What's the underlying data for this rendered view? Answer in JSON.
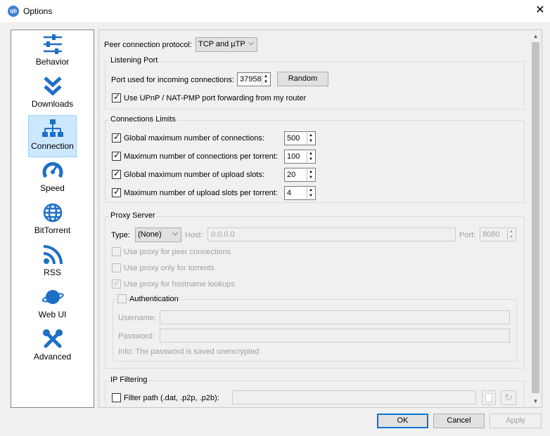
{
  "window": {
    "title": "Options",
    "app_icon": "qb"
  },
  "sidebar": {
    "items": [
      {
        "label": "Behavior",
        "icon": "sliders-icon"
      },
      {
        "label": "Downloads",
        "icon": "double-chevron-down-icon"
      },
      {
        "label": "Connection",
        "icon": "network-icon",
        "selected": true
      },
      {
        "label": "Speed",
        "icon": "speedometer-icon"
      },
      {
        "label": "BitTorrent",
        "icon": "globe-icon"
      },
      {
        "label": "RSS",
        "icon": "rss-icon"
      },
      {
        "label": "Web UI",
        "icon": "planet-icon"
      },
      {
        "label": "Advanced",
        "icon": "tools-icon"
      }
    ]
  },
  "protocol": {
    "label": "Peer connection protocol:",
    "value": "TCP and µTP"
  },
  "listening": {
    "title": "Listening Port",
    "port_label": "Port used for incoming connections:",
    "port_value": "37958",
    "random_button": "Random",
    "upnp_label": "Use UPnP / NAT-PMP port forwarding from my router"
  },
  "limits": {
    "title": "Connections Limits",
    "rows": [
      {
        "label": "Global maximum number of connections:",
        "value": "500"
      },
      {
        "label": "Maximum number of connections per torrent:",
        "value": "100"
      },
      {
        "label": "Global maximum number of upload slots:",
        "value": "20"
      },
      {
        "label": "Maximum number of upload slots per torrent:",
        "value": "4"
      }
    ]
  },
  "proxy": {
    "title": "Proxy Server",
    "type_label": "Type:",
    "type_value": "(None)",
    "host_label": "Host:",
    "host_value": "0.0.0.0",
    "port_label": "Port:",
    "port_value": "8080",
    "peer_label": "Use proxy for peer connections",
    "torrents_label": "Use proxy only for torrents",
    "hostname_label": "Use proxy for hostname lookups",
    "auth_label": "Authentication",
    "username_label": "Username:",
    "password_label": "Password:",
    "info": "Info: The password is saved unencrypted"
  },
  "ipfilter": {
    "title": "IP Filtering",
    "path_label": "Filter path (.dat, .p2p, .p2b):"
  },
  "footer": {
    "ok": "OK",
    "cancel": "Cancel",
    "apply": "Apply"
  },
  "colors": {
    "accent": "#0078d7",
    "selection": "#cce8ff",
    "icon_blue": "#1e6fc6"
  }
}
